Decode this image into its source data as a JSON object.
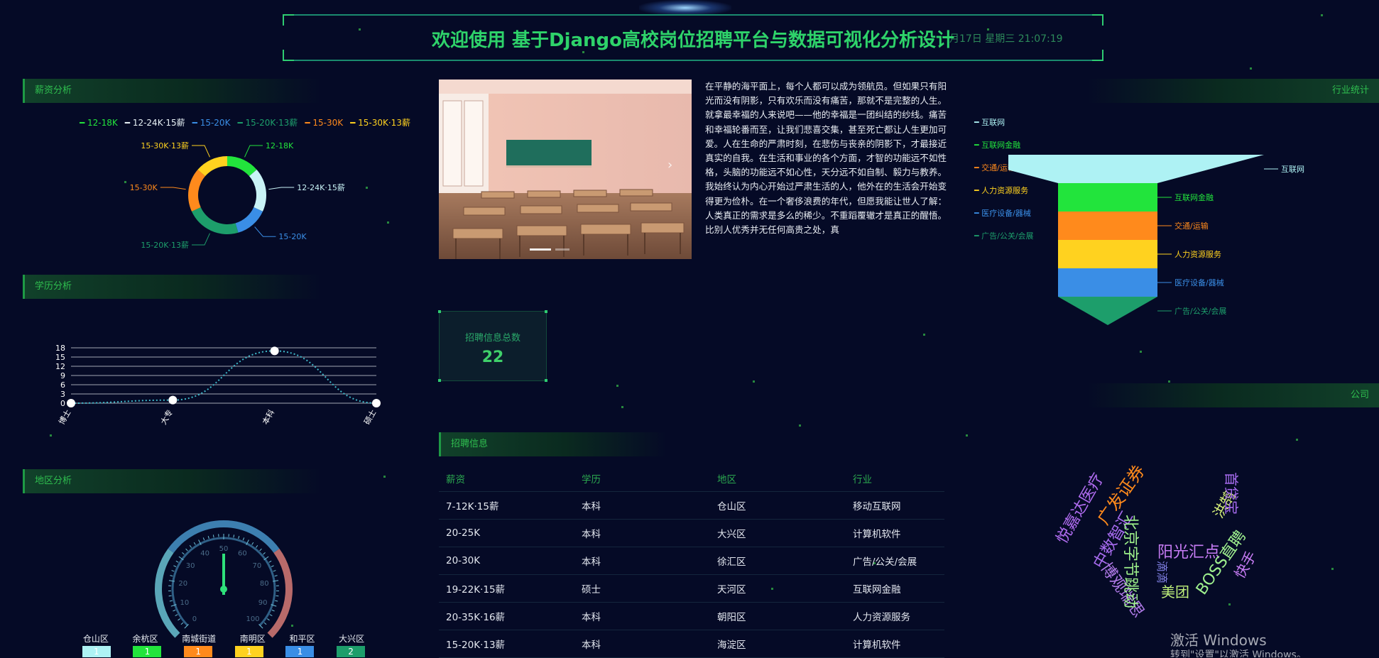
{
  "header": {
    "title": "欢迎使用 基于Django高校岗位招聘平台与数据可视化分析设计",
    "clock": "月17日 星期三 21:07:19"
  },
  "panels": {
    "salary": "薪资分析",
    "education": "学历分析",
    "region": "地区分析",
    "industry": "行业统计",
    "company": "公司",
    "jobs": "招聘信息"
  },
  "salary_legend": [
    {
      "label": "12-18K",
      "color": "#22e43c"
    },
    {
      "label": "12-24K·15薪",
      "color": "#e9f3f7"
    },
    {
      "label": "15-20K",
      "color": "#3a8ee6"
    },
    {
      "label": "15-20K·13薪",
      "color": "#1d9e6b"
    },
    {
      "label": "15-30K",
      "color": "#ff8a1c"
    },
    {
      "label": "15-30K·13薪",
      "color": "#ffd21f"
    }
  ],
  "essay": "在平静的海平面上，每个人都可以成为领航员。但如果只有阳光而没有阴影，只有欢乐而没有痛苦，那就不是完整的人生。就拿最幸福的人来说吧——他的幸福是一团纠结的纱线。痛苦和幸福轮番而至，让我们悲喜交集，甚至死亡都让人生更加可爱。人在生命的严肃时刻，在悲伤与丧亲的阴影下，才最接近真实的自我。在生活和事业的各个方面，才智的功能远不如性格，头脑的功能远不如心性，天分远不如自制、毅力与教养。我始终认为内心开始过严肃生活的人，他外在的生活会开始变得更为俭朴。在一个奢侈浪费的年代，但愿我能让世人了解：人类真正的需求是多么的稀少。不重蹈覆辙才是真正的醒悟。比别人优秀并无任何高贵之处，真",
  "total": {
    "label": "招聘信息总数",
    "value": "22"
  },
  "jobs_table": {
    "headers": [
      "薪资",
      "学历",
      "地区",
      "行业"
    ],
    "rows": [
      [
        "7-12K·15薪",
        "本科",
        "仓山区",
        "移动互联网"
      ],
      [
        "20-25K",
        "本科",
        "大兴区",
        "计算机软件"
      ],
      [
        "20-30K",
        "本科",
        "徐汇区",
        "广告/公关/会展"
      ],
      [
        "19-22K·15薪",
        "硕士",
        "天河区",
        "互联网金融"
      ],
      [
        "20-35K·16薪",
        "本科",
        "朝阳区",
        "人力资源服务"
      ],
      [
        "15-20K·13薪",
        "本科",
        "海淀区",
        "计算机软件"
      ]
    ]
  },
  "industry_legend": [
    {
      "label": "互联网",
      "color": "#aef2f4"
    },
    {
      "label": "互联网金融",
      "color": "#22e43c"
    },
    {
      "label": "交通/运输",
      "color": "#ff8a1c"
    },
    {
      "label": "人力资源服务",
      "color": "#ffd21f"
    },
    {
      "label": "医疗设备/器械",
      "color": "#3a8ee6"
    },
    {
      "label": "广告/公关/会展",
      "color": "#1d9e6b"
    }
  ],
  "region_labels": [
    "仓山区",
    "余杭区",
    "南城街道",
    "南明区",
    "和平区",
    "大兴区"
  ],
  "region_bar_colors": [
    "#aef2f4",
    "#22e43c",
    "#ff8a1c",
    "#ffd21f",
    "#3a8ee6",
    "#1d9e6b"
  ],
  "region_bar_values": [
    "1",
    "1",
    "1",
    "1",
    "1",
    "2"
  ],
  "gauge": {
    "ticks": [
      "0",
      "10",
      "20",
      "30",
      "40",
      "50",
      "60",
      "70",
      "80",
      "90",
      "100"
    ],
    "value": 50
  },
  "company_words": [
    {
      "text": "悦嘉达医疗",
      "color": "#b06cf0"
    },
    {
      "text": "广发证券",
      "color": "#ff8a1c"
    },
    {
      "text": "中数智汇",
      "color": "#a86cf0"
    },
    {
      "text": "博观瑞思",
      "color": "#b07ae8"
    },
    {
      "text": "北京字节跳动",
      "color": "#9df08a"
    },
    {
      "text": "阳光汇点",
      "color": "#c77cf5"
    },
    {
      "text": "滴滴",
      "color": "#7d7de0"
    },
    {
      "text": "美团",
      "color": "#bfef7a"
    },
    {
      "text": "BOSS直聘",
      "color": "#9ef08e"
    },
    {
      "text": "快手",
      "color": "#c77cf5"
    },
    {
      "text": "洪鹄",
      "color": "#d6f07a"
    },
    {
      "text": "首贷宝",
      "color": "#a86cf0"
    }
  ],
  "windows_watermark": {
    "line1": "激活 Windows",
    "line2": "转到\"设置\"以激活 Windows。"
  },
  "chart_data": [
    {
      "type": "pie",
      "title": "",
      "categories": [
        "12-18K",
        "12-24K·15薪",
        "15-20K",
        "15-20K·13薪",
        "15-30K",
        "15-30K·13薪"
      ],
      "values": [
        3,
        4,
        3,
        5,
        4,
        3
      ],
      "colors": [
        "#22e43c",
        "#c9f3f6",
        "#3a8ee6",
        "#1d9e6b",
        "#ff8a1c",
        "#ffd21f"
      ],
      "legend": "top"
    },
    {
      "type": "line",
      "title": "",
      "categories": [
        "博士",
        "大专",
        "本科",
        "硕士"
      ],
      "values": [
        0,
        1,
        17,
        0
      ],
      "ylim": [
        0,
        18
      ],
      "yticks": [
        "0",
        "3",
        "6",
        "9",
        "12",
        "15",
        "18"
      ],
      "grid": true,
      "smooth": true
    },
    {
      "type": "bar",
      "title": "",
      "categories": [
        "互联网",
        "互联网金融",
        "交通/运输",
        "人力资源服务",
        "医疗设备/器械",
        "广告/公关/会展"
      ],
      "values": [
        6,
        5,
        4,
        4,
        3,
        2
      ],
      "note": "funnel"
    }
  ]
}
